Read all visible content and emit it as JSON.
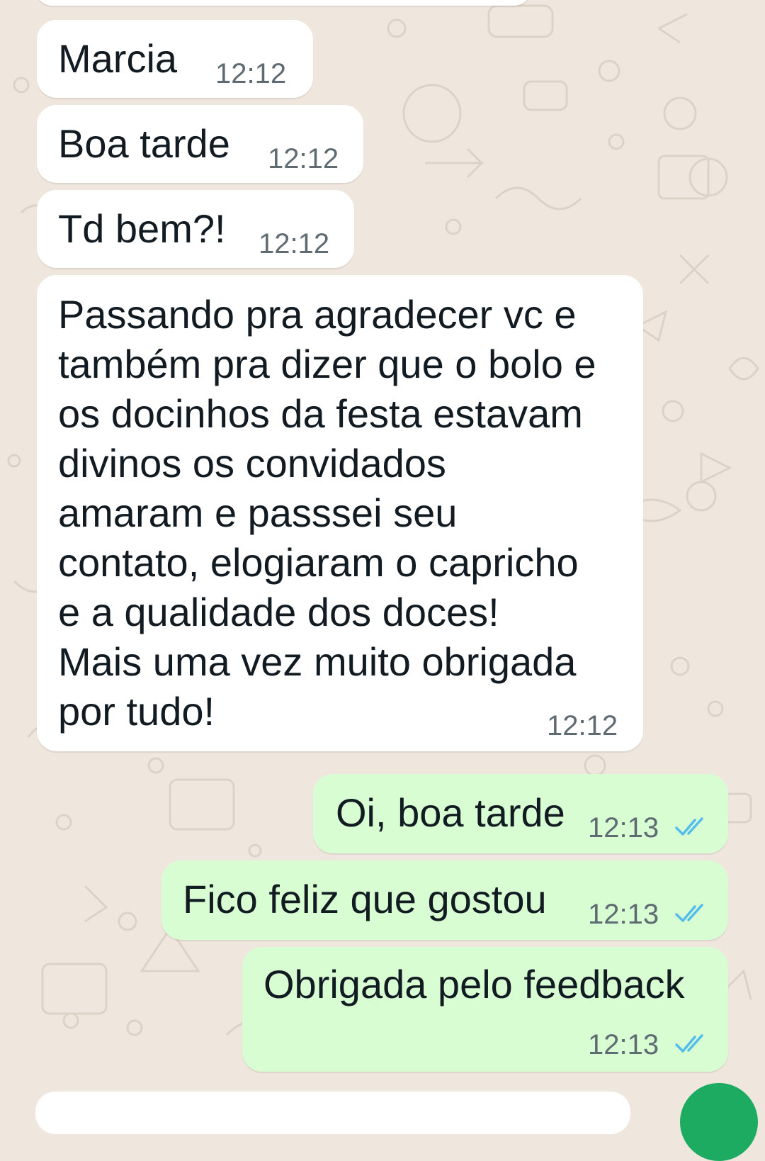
{
  "colors": {
    "wallpaper": "#efe7de",
    "incoming_bubble": "#ffffff",
    "outgoing_bubble": "#d9fdd3",
    "timestamp": "#5f6b72",
    "read_ticks": "#53bdeb"
  },
  "messages": [
    {
      "direction": "incoming",
      "lines": [
        "Marcia"
      ],
      "time": "12:12"
    },
    {
      "direction": "incoming",
      "lines": [
        "Boa tarde"
      ],
      "time": "12:12"
    },
    {
      "direction": "incoming",
      "lines": [
        "Td bem?!"
      ],
      "time": "12:12"
    },
    {
      "direction": "incoming",
      "lines": [
        "Passando pra agradecer vc e",
        "também pra dizer que o bolo e",
        "os docinhos da festa estavam",
        "divinos os convidados",
        "amaram e passsei seu",
        "contato, elogiaram o capricho",
        "e a qualidade dos doces!",
        "Mais uma vez muito obrigada",
        "por tudo!"
      ],
      "time": "12:12"
    },
    {
      "direction": "outgoing",
      "lines": [
        "Oi, boa tarde"
      ],
      "time": "12:13",
      "status_icon": "double-check-read-icon"
    },
    {
      "direction": "outgoing",
      "lines": [
        "Fico feliz que gostou"
      ],
      "time": "12:13",
      "status_icon": "double-check-read-icon"
    },
    {
      "direction": "outgoing",
      "lines": [
        "Obrigada pelo feedback"
      ],
      "time": "12:13",
      "status_icon": "double-check-read-icon"
    }
  ]
}
